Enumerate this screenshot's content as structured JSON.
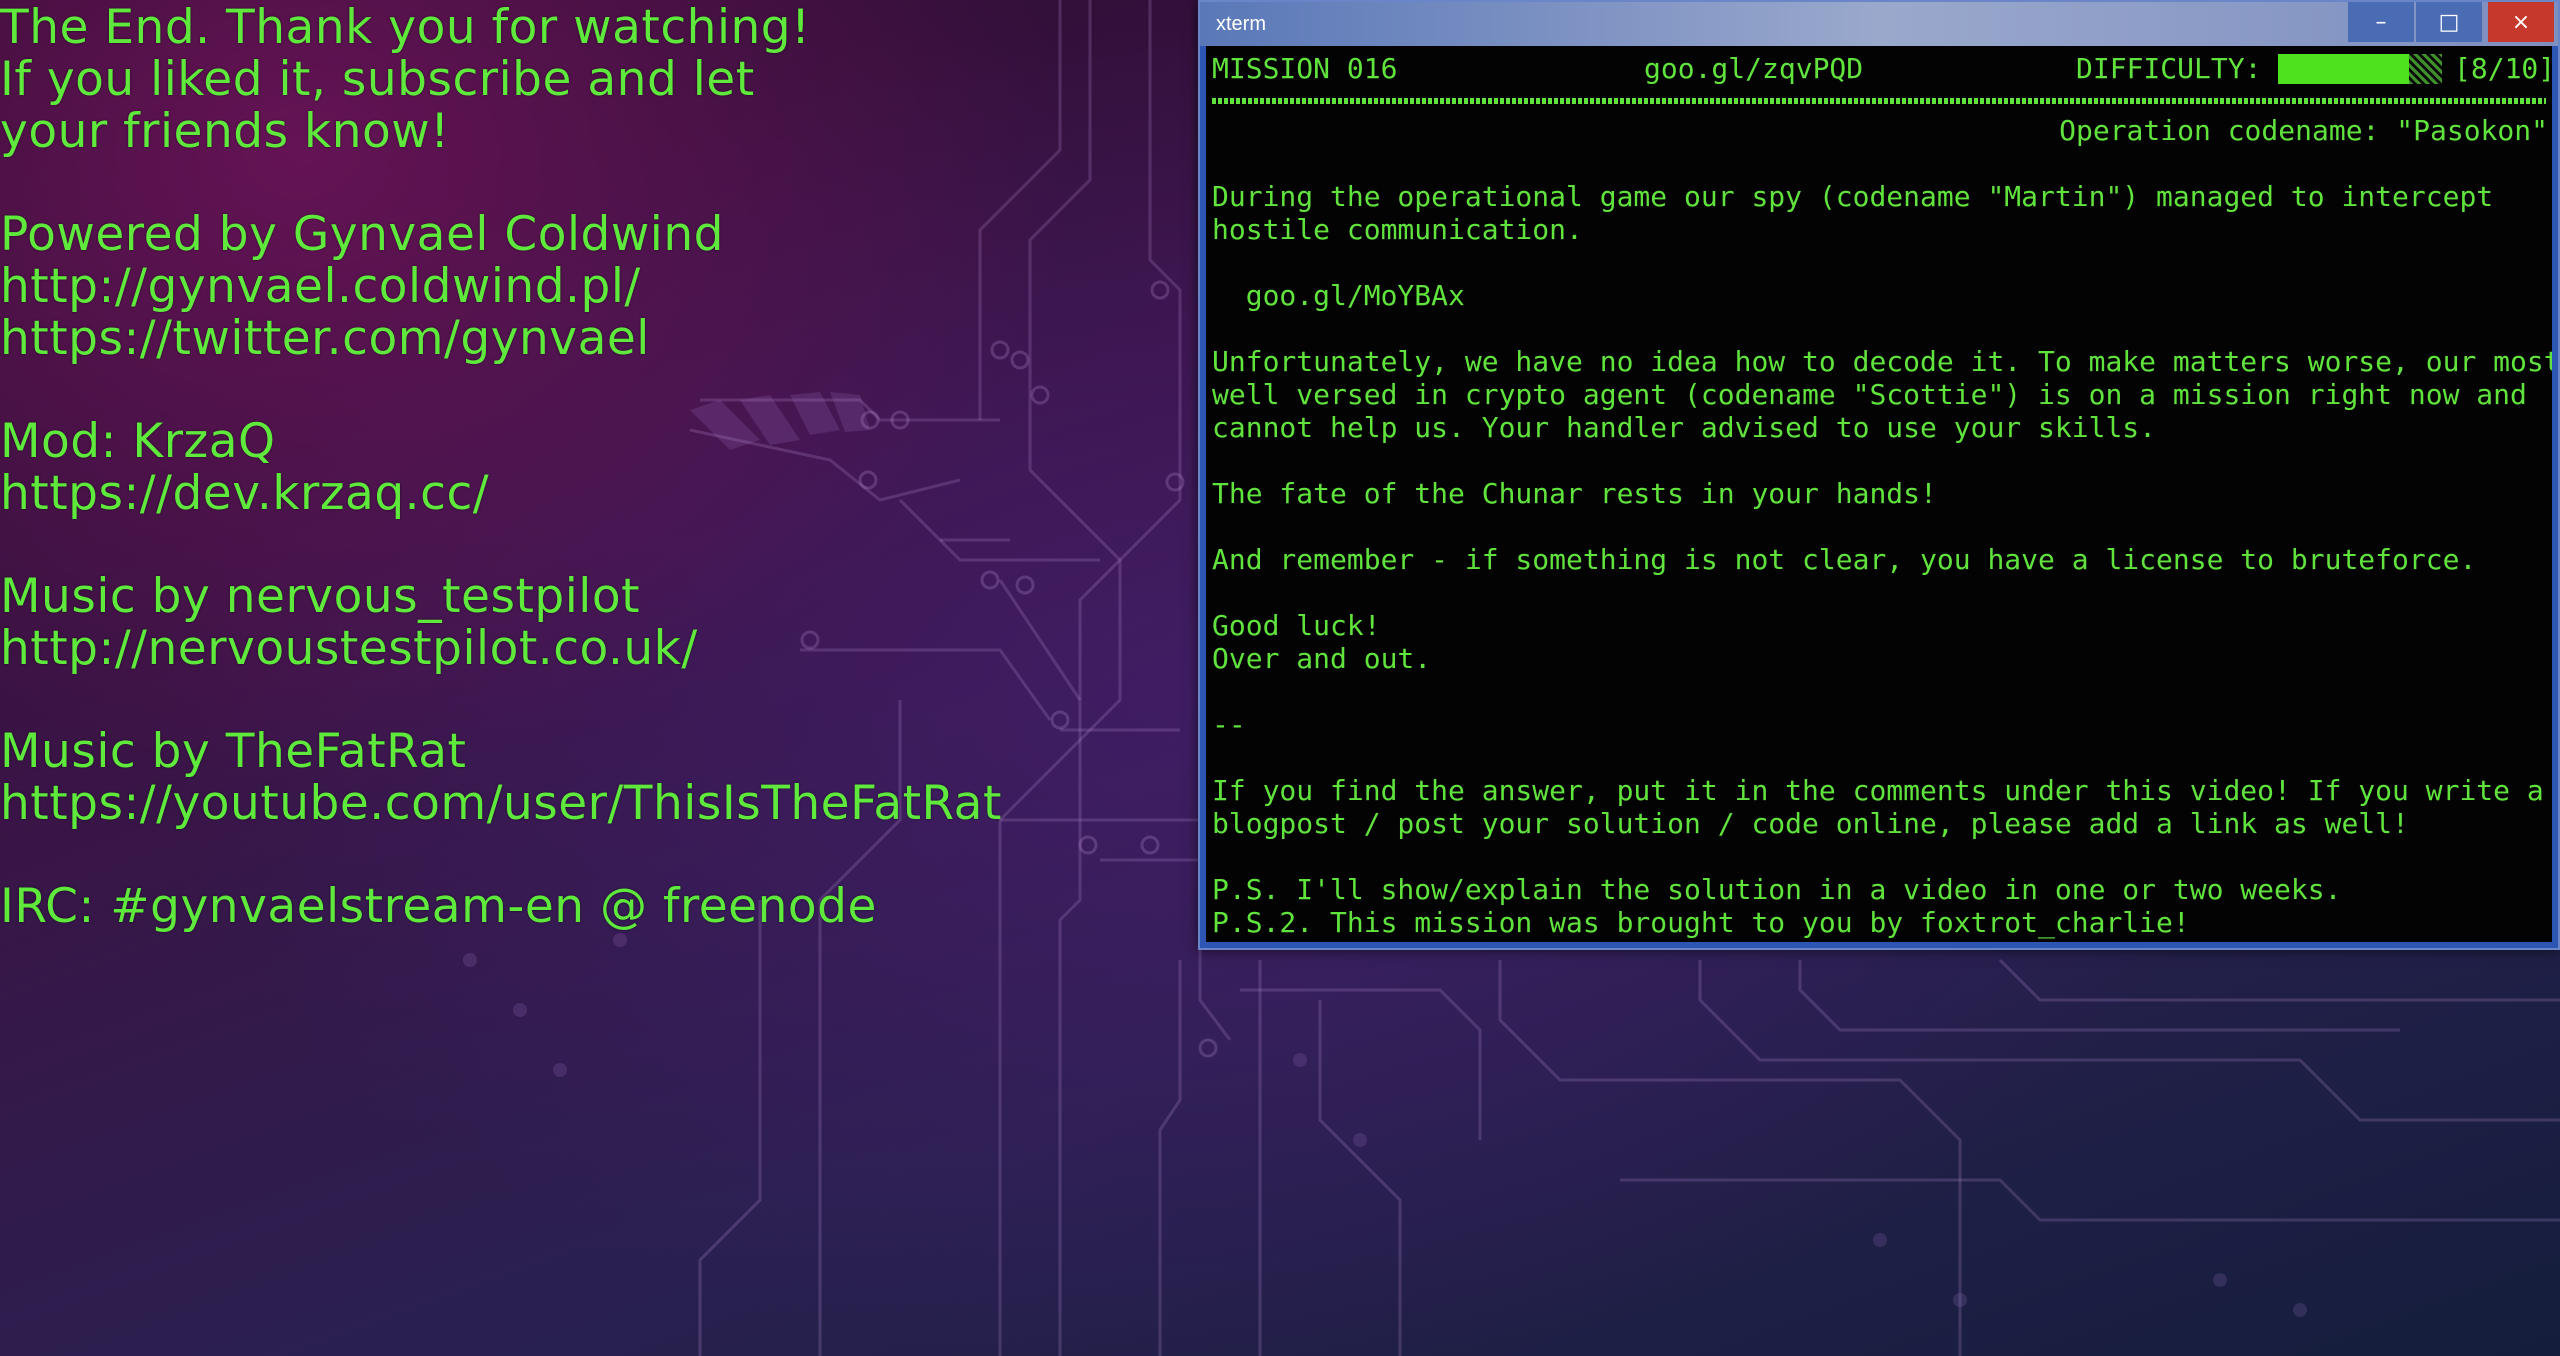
{
  "credits": {
    "lines": [
      "The End. Thank you for watching!",
      "If you liked it, subscribe and let",
      "your friends know!",
      "",
      "Powered by Gynvael Coldwind",
      "http://gynvael.coldwind.pl/",
      "https://twitter.com/gynvael",
      "",
      "Mod: KrzaQ",
      "https://dev.krzaq.cc/",
      "",
      "Music by nervous_testpilot",
      "http://nervoustestpilot.co.uk/",
      "",
      "Music by TheFatRat",
      "https://youtube.com/user/ThisIsTheFatRat",
      "",
      "IRC: #gynvaelstream-en @ freenode"
    ]
  },
  "window": {
    "title": "xterm",
    "minimize_label": "–",
    "maximize_label": "□",
    "close_label": "×"
  },
  "terminal": {
    "mission": "MISSION 016",
    "link": "goo.gl/zqvPQD",
    "difficulty_label": "DIFFICULTY:",
    "difficulty_text": "[8/10]",
    "difficulty_level": 0.8,
    "codename": "Operation codename: \"Pasokon\"",
    "body_lines": [
      "",
      "During the operational game our spy (codename \"Martin\") managed to intercept",
      "hostile communication.",
      "",
      "  goo.gl/MoYBAx",
      "",
      "Unfortunately, we have no idea how to decode it. To make matters worse, our most",
      "well versed in crypto agent (codename \"Scottie\") is on a mission right now and",
      "cannot help us. Your handler advised to use your skills.",
      "",
      "The fate of the Chunar rests in your hands!",
      "",
      "And remember - if something is not clear, you have a license to bruteforce.",
      "",
      "Good luck!",
      "Over and out.",
      "",
      "--",
      "",
      "If you find the answer, put it in the comments under this video! If you write a",
      "blogpost / post your solution / code online, please add a link as well!",
      "",
      "P.S. I'll show/explain the solution in a video in one or two weeks.",
      "P.S.2. This mission was brought to you by foxtrot_charlie!"
    ]
  },
  "colors": {
    "text_green": "#5fe93c",
    "terminal_bg": "#030303",
    "titlebar_blue": "#2c55b4",
    "close_red": "#c7382c"
  }
}
